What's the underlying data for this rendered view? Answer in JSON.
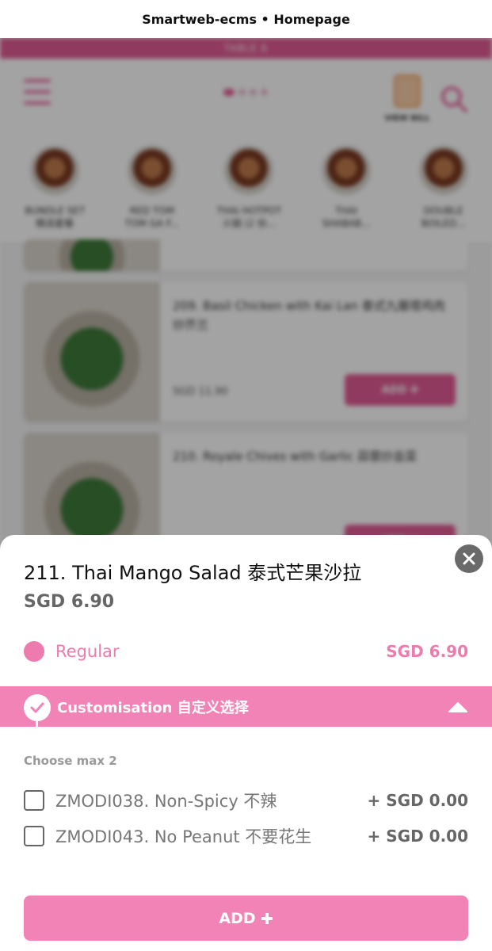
{
  "browser": {
    "title": "Smartweb-ecms • Homepage"
  },
  "background": {
    "table_label": "TABLE 6",
    "view_bill_label": "VIEW BILL",
    "categories": [
      {
        "label": "BUNDLE SET",
        "sub": "精选套餐"
      },
      {
        "label": "RED TOM",
        "sub": "TOM GA F..."
      },
      {
        "label": "THAI HOTPOT",
        "sub": "火锅 (2 份..."
      },
      {
        "label": "THAI",
        "sub": "SHABAB..."
      },
      {
        "label": "DOUBLE",
        "sub": "BOILED..."
      }
    ],
    "items": [
      {
        "title": "209. Basil Chicken with Kai Lan 泰式九層塔鸡肉炒芥兰",
        "price": "SGD 11.90",
        "add": "ADD ✚"
      },
      {
        "title": "210. Royale Chives with Garlic 蒜蓉炒韭菜",
        "price": "",
        "add": "ADD ✚"
      }
    ]
  },
  "sheet": {
    "item_title": "211. Thai Mango Salad 泰式芒果沙拉",
    "item_price": "SGD 6.90",
    "variant": {
      "name": "Regular",
      "price": "SGD 6.90"
    },
    "customisation": {
      "title": "Customisation 自定义选择",
      "choose_max": "Choose max 2",
      "options": [
        {
          "name": "ZMODI038. Non-Spicy 不辣",
          "price": "+ SGD 0.00",
          "checked": false
        },
        {
          "name": "ZMODI043. No Peanut 不要花生",
          "price": "+ SGD 0.00",
          "checked": false
        }
      ]
    },
    "add_button": {
      "label": "ADD",
      "icon": "plus-icon"
    }
  },
  "colors": {
    "accent_pink": "#f283b6",
    "dark_pink": "#e25c95",
    "close_button": "#6a6a6a"
  }
}
